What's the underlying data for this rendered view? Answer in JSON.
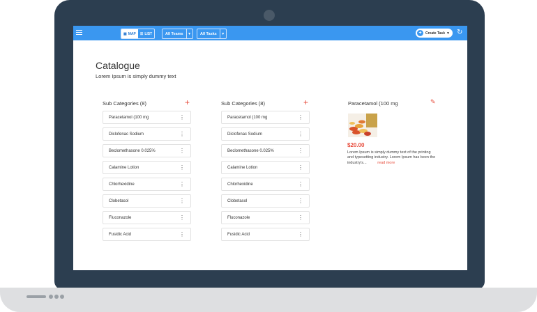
{
  "header": {
    "view_toggle": {
      "map_label": "MAP",
      "list_label": "LIST"
    },
    "teams_dropdown": "All Teams",
    "tasks_dropdown": "All Tasks",
    "create_task_label": "Create Task"
  },
  "page": {
    "title": "Catalogue",
    "subtitle": "Lorem Ipsum is simply dummy text"
  },
  "columns": [
    {
      "header": "Sub Categories (8)",
      "items": [
        "Paracetamol (100 mg",
        "Diclofenac Sodium",
        "Beclomethasone 0.025%",
        "Calamine Lotion",
        "Chlorhexidine",
        "Clobetasol",
        "Fluconazole",
        "Fusidic Acid"
      ]
    },
    {
      "header": "Sub Categories (8)",
      "items": [
        "Paracetamol (100 mg",
        "Diclofenac Sodium",
        "Beclomethasone 0.025%",
        "Calamine Lotion",
        "Chlorhexidine",
        "Clobetasol",
        "Fluconazole",
        "Fusidic Acid"
      ]
    }
  ],
  "detail": {
    "title": "Paracetamol (100 mg",
    "price": "$20.00",
    "description": "Lorem Ipsum is simply dummy text of the printing and typesetting industry. Lorem Ipsum has been the industry's...",
    "read_more": "read more"
  },
  "colors": {
    "brand_blue": "#3a97f0",
    "accent_red": "#e74c3c",
    "laptop_body": "#2c3e50"
  }
}
